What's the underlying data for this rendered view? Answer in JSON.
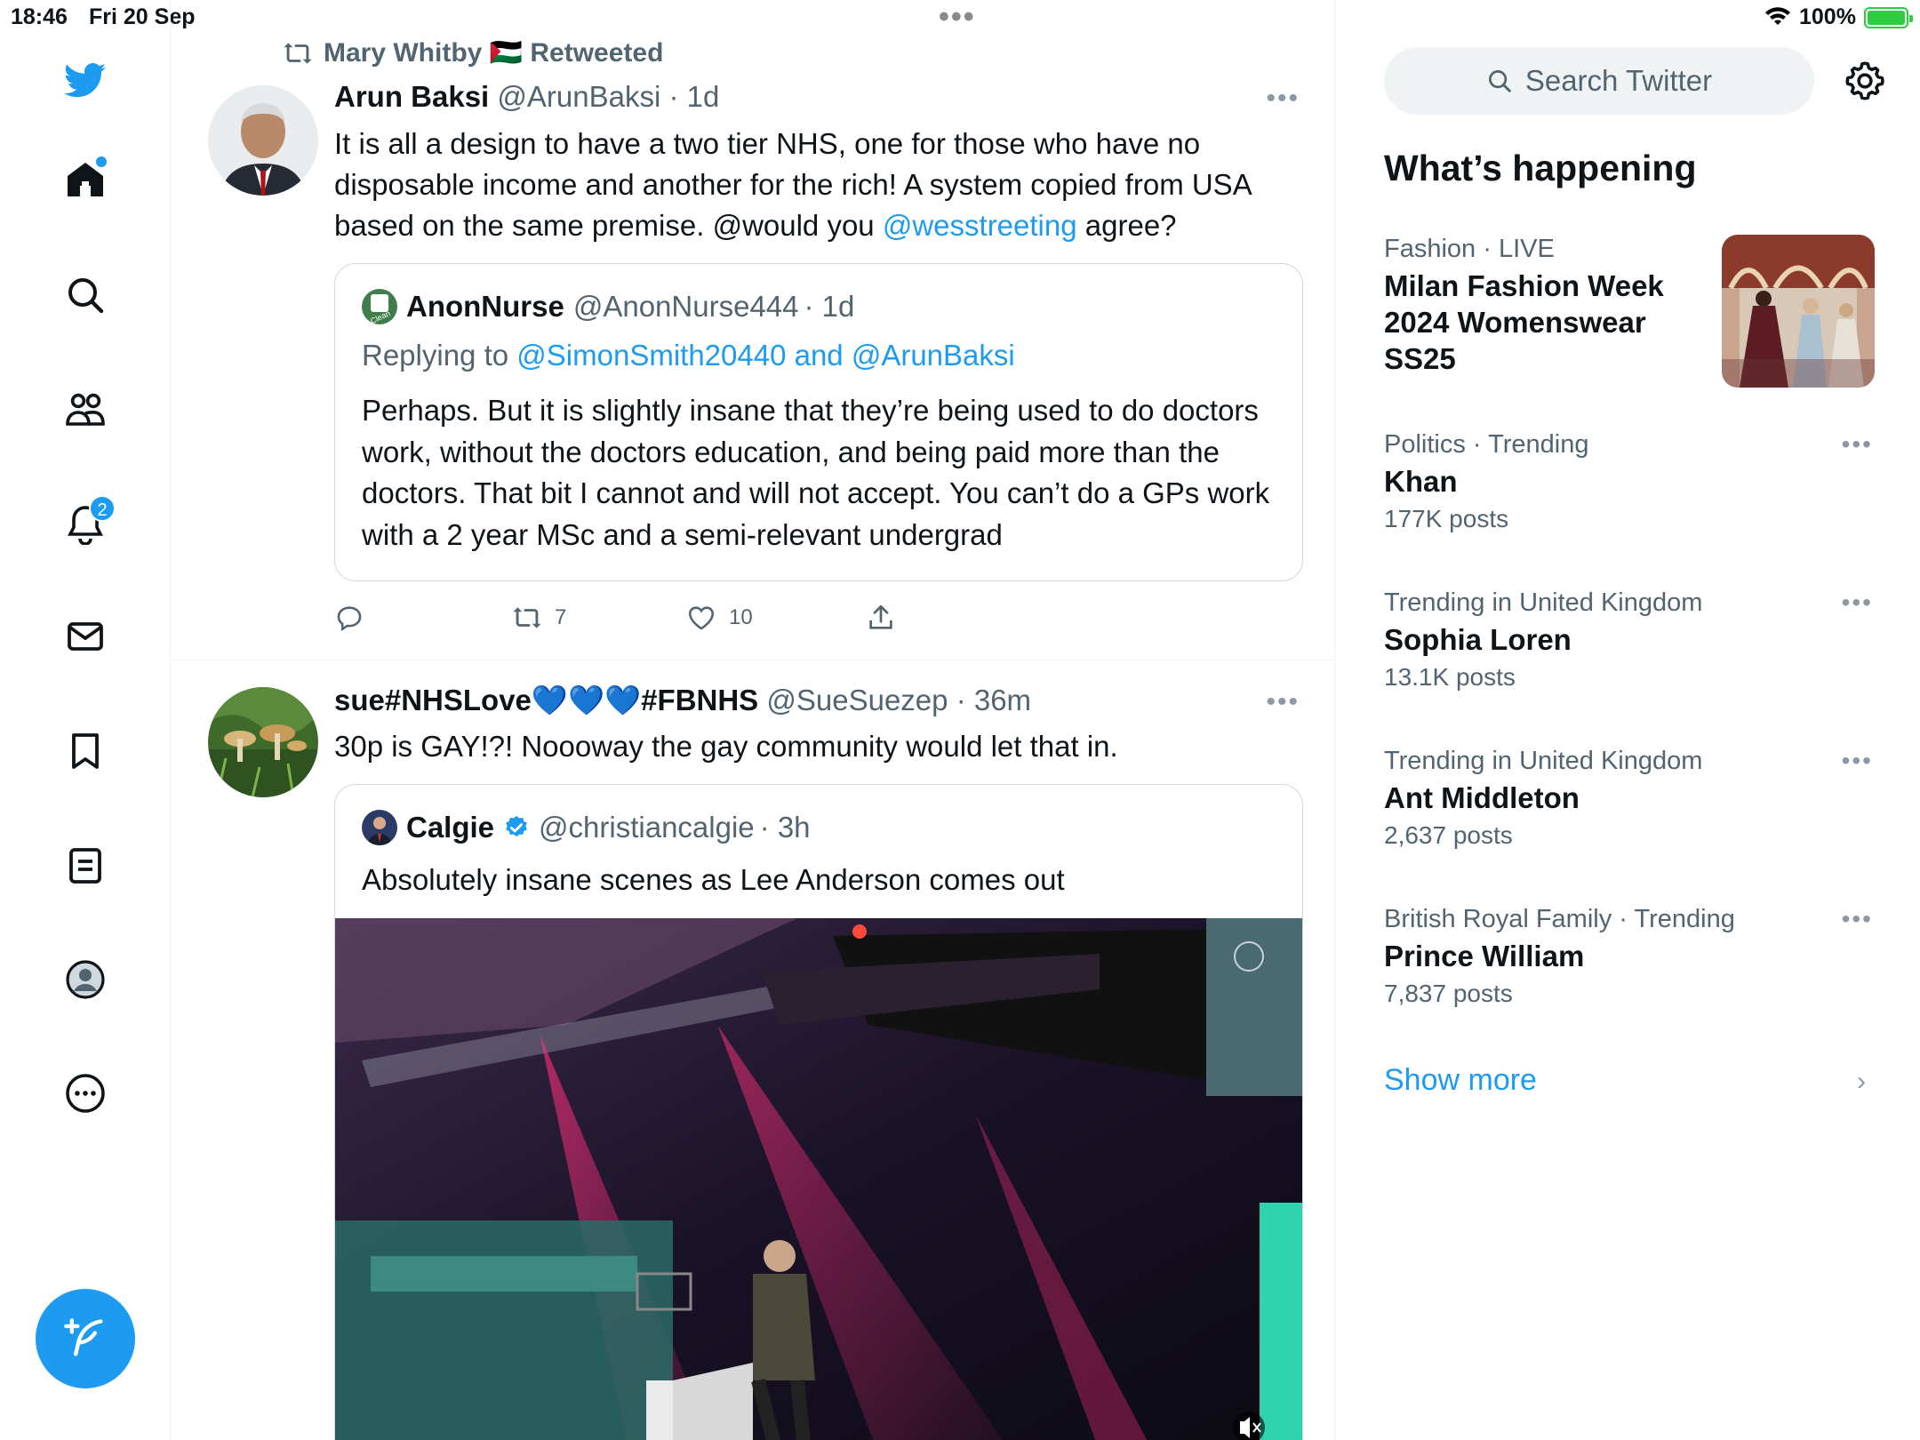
{
  "status": {
    "time": "18:46",
    "date": "Fri 20 Sep",
    "battery": "100%",
    "battery_level": 1.0
  },
  "nav": {
    "notifications_badge": "2"
  },
  "tweets": [
    {
      "retweeted_by": "Mary Whitby 🇵🇸 Retweeted",
      "name": "Arun Baksi",
      "handle": "@ArunBaksi",
      "time": "· 1d",
      "text_before": "It is all a design to have a two tier NHS, one for those who have no disposable income and another for the rich! A system copied from USA based on the same premise. @would you ",
      "mention": "@wesstreeting",
      "text_after": " agree?",
      "quote": {
        "name": "AnonNurse",
        "handle": "@AnonNurse444",
        "time": "· 1d",
        "replying_label": "Replying to",
        "replying_to": "@SimonSmith20440 and @ArunBaksi",
        "text": "Perhaps. But it is slightly insane that they’re being used to do doctors work, without the doctors education, and being paid more than the doctors. That bit I cannot and will not accept. You can’t do a GPs work with a 2 year MSc and a semi-relevant undergrad"
      },
      "retweets": "7",
      "likes": "10"
    },
    {
      "name": "sue#NHSLove💙💙💙#FBNHS",
      "handle": "@SueSuezep",
      "time": "· 36m",
      "text": "30p is GAY!?! Noooway the gay community would let that in.",
      "quote": {
        "name": "Calgie",
        "handle": "@christiancalgie",
        "time": "· 3h",
        "text": "Absolutely insane scenes as Lee Anderson comes out"
      }
    }
  ],
  "sidebar": {
    "search_placeholder": "Search Twitter",
    "heading": "What’s happening",
    "trends": [
      {
        "meta": "Fashion · LIVE",
        "title": "Milan Fashion Week 2024 Womenswear SS25",
        "count": ""
      },
      {
        "meta": "Politics · Trending",
        "title": "Khan",
        "count": "177K posts"
      },
      {
        "meta": "Trending in United Kingdom",
        "title": "Sophia Loren",
        "count": "13.1K posts"
      },
      {
        "meta": "Trending in United Kingdom",
        "title": "Ant Middleton",
        "count": "2,637 posts"
      },
      {
        "meta": "British Royal Family · Trending",
        "title": "Prince William",
        "count": "7,837 posts"
      }
    ],
    "show_more": "Show more"
  }
}
